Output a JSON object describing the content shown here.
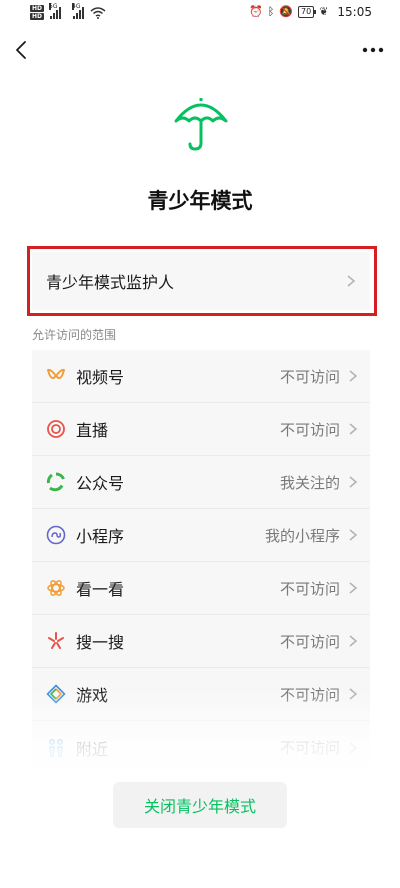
{
  "status_bar": {
    "hd_top": "HD",
    "hd_bottom": "HD",
    "net1": "5G",
    "net2": "4G",
    "battery": "70",
    "time": "15:05"
  },
  "page": {
    "title": "青少年模式",
    "accent_color": "#07c160",
    "highlight_color": "#d51f25"
  },
  "guardian": {
    "label": "青少年模式监护人"
  },
  "section": {
    "label": "允许访问的范围"
  },
  "items": [
    {
      "name": "视频号",
      "value": "不可访问",
      "icon": "channels-icon"
    },
    {
      "name": "直播",
      "value": "不可访问",
      "icon": "live-icon"
    },
    {
      "name": "公众号",
      "value": "我关注的",
      "icon": "official-accounts-icon"
    },
    {
      "name": "小程序",
      "value": "我的小程序",
      "icon": "mini-programs-icon"
    },
    {
      "name": "看一看",
      "value": "不可访问",
      "icon": "top-stories-icon"
    },
    {
      "name": "搜一搜",
      "value": "不可访问",
      "icon": "search-icon"
    },
    {
      "name": "游戏",
      "value": "不可访问",
      "icon": "games-icon"
    },
    {
      "name": "附近",
      "value": "不可访问",
      "icon": "nearby-icon"
    }
  ],
  "footer": {
    "close_button": "关闭青少年模式"
  }
}
